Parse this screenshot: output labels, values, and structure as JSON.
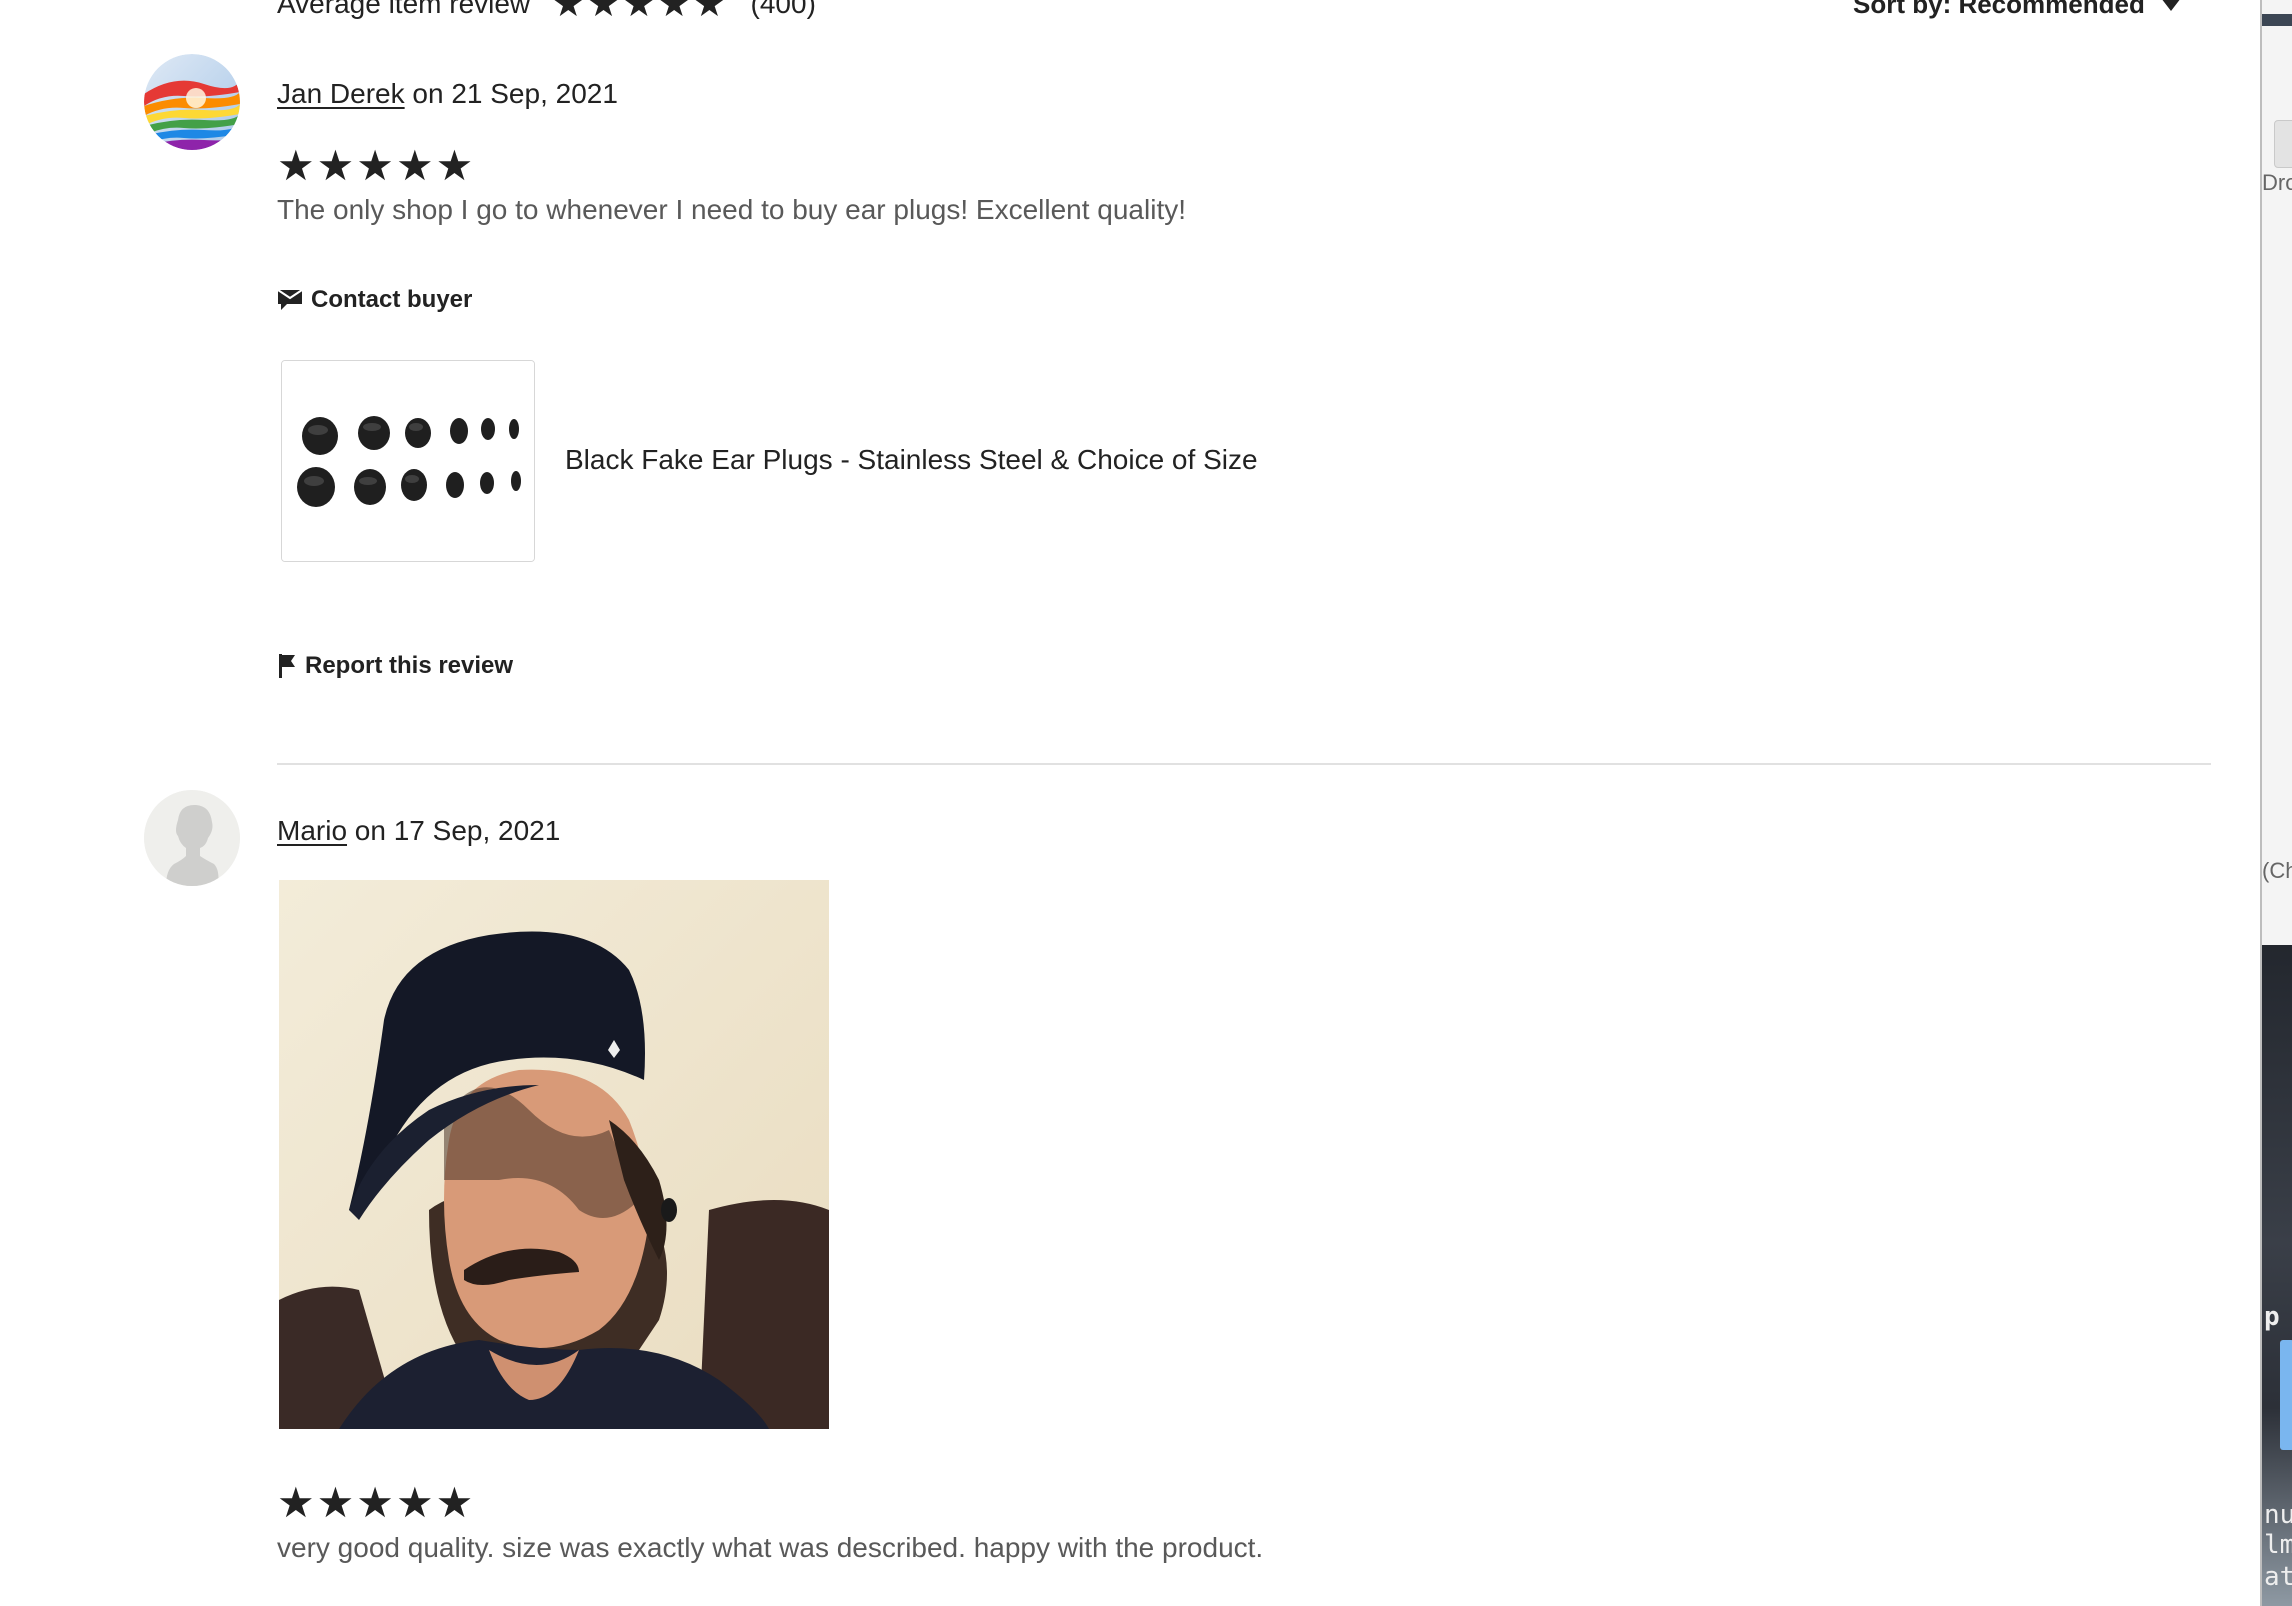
{
  "summary": {
    "label": "Average item review",
    "stars": "★★★★★",
    "count": "(400)"
  },
  "sort": {
    "label": "Sort by: Recommended"
  },
  "reviews": [
    {
      "reviewer": "Jan Derek",
      "date_text": "on 21 Sep, 2021",
      "stars": "★★★★★",
      "rating": 5,
      "text": "The only shop I go to whenever I need to buy ear plugs! Excellent quality!",
      "contact_label": "Contact buyer",
      "product_title": "Black Fake Ear Plugs - Stainless Steel & Choice of Size",
      "report_label": "Report this review"
    },
    {
      "reviewer": "Mario",
      "date_text": "on 17 Sep, 2021",
      "stars": "★★★★★",
      "rating": 5,
      "text": "very good quality. size was exactly what was described. happy with the product."
    }
  ],
  "side_window": {
    "label_top": "Dro",
    "label_mid": "(Ch",
    "label_p": "p",
    "label_nu": "nu",
    "label_im": "lm",
    "label_at": "at"
  },
  "colors": {
    "text_primary": "#222222",
    "text_secondary": "#595959",
    "divider": "#e1e1e1"
  }
}
